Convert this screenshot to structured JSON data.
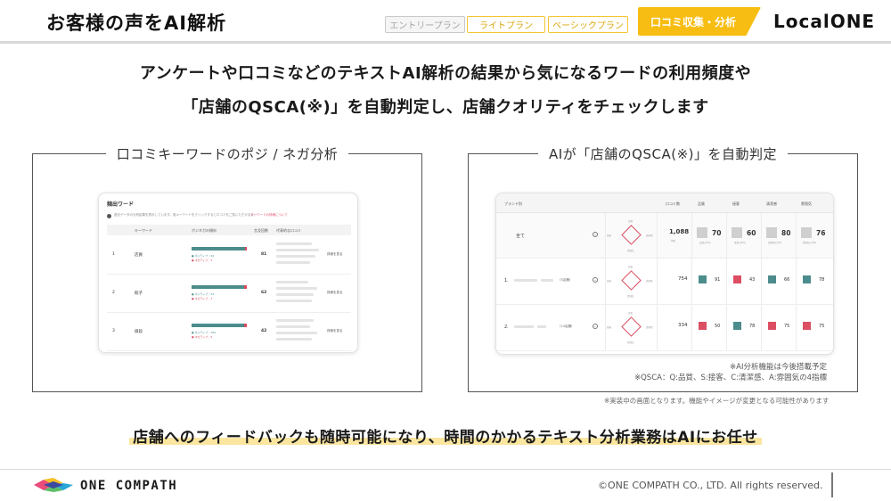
{
  "header": {
    "title": "お客様の声をAI解析",
    "plans": [
      "エントリープラン",
      "ライトプラン",
      "ベーシックプラン"
    ],
    "active_plan": "口コミ収集・分析",
    "brand": "LocalONE"
  },
  "headline": {
    "line1": "アンケートや口コミなどのテキストAI解析の結果から気になるワードの利用頻度や",
    "line2": "「店舗のQSCA(※)」を自動判定し、店舗クオリティをチェックします"
  },
  "left_panel": {
    "label": "口コミキーワードのポジ / ネガ分析",
    "card": {
      "title": "頻出ワード",
      "note": "過去データの分析結果を表示しています。各キーワードをクリックすると口コミをご覧いただけます。",
      "note_link": "キーワードの詳細について",
      "columns": [
        "キーワード",
        "ポジネガの傾向",
        "言及回数",
        "代表的な口コミ"
      ],
      "rows": [
        {
          "rank": "1",
          "word": "店員",
          "pos": "● ポジティブ：64",
          "neg": "● ネガティブ：5",
          "count": "81",
          "pos_ratio": 0.96,
          "detail": "詳細を見る"
        },
        {
          "rank": "2",
          "word": "餃子",
          "pos": "● ポジティブ：54",
          "neg": "● ネガティブ：3",
          "count": "62",
          "pos_ratio": 0.95,
          "detail": "詳細を見る"
        },
        {
          "rank": "3",
          "word": "値段",
          "pos": "● ポジティブ：100",
          "neg": "● ネガティブ：5",
          "count": "42",
          "pos_ratio": 0.95,
          "detail": "詳細を見る"
        }
      ]
    }
  },
  "right_panel": {
    "label": "AIが「店舗のQSCA(※)」を自動判定",
    "card": {
      "columns": [
        "ブランド別",
        "口コミ数",
        "品質",
        "接客",
        "清潔感",
        "雰囲気"
      ],
      "axis_labels": [
        "品質",
        "接客",
        "清潔感",
        "雰囲気"
      ],
      "total_row": {
        "label": "全て",
        "count": "1,088",
        "count_unit": "件数",
        "scores": [
          {
            "value": "70",
            "avg": "品質の平均"
          },
          {
            "value": "60",
            "avg": "接客の平均"
          },
          {
            "value": "80",
            "avg": "清潔感の平均"
          },
          {
            "value": "76",
            "avg": "雰囲気の平均"
          }
        ]
      },
      "rows": [
        {
          "rank": "1.",
          "sub": "（5店舗）",
          "count": "754",
          "scores": [
            {
              "value": "91",
              "color": "#4d8c8c"
            },
            {
              "value": "43",
              "color": "#dc4f63"
            },
            {
              "value": "66",
              "color": "#4d8c8c"
            },
            {
              "value": "78",
              "color": "#4d8c8c"
            }
          ]
        },
        {
          "rank": "2.",
          "sub": "（14店舗）",
          "count": "334",
          "scores": [
            {
              "value": "50",
              "color": "#dc4f63"
            },
            {
              "value": "78",
              "color": "#4d8c8c"
            },
            {
              "value": "75",
              "color": "#dc4f63"
            },
            {
              "value": "75",
              "color": "#dc4f63"
            }
          ]
        }
      ]
    },
    "notes": [
      "※AI分析機能は今後搭載予定",
      "※QSCA：Q:品質、S:接客、C:清潔感、A:雰囲気の4指標"
    ]
  },
  "disclaimer": "※実装中の画面となります。機能やイメージが変更となる可能性があります",
  "bottom_message": "店舗へのフィードバックも随時可能になり、時間のかかるテキスト分析業務はAIにお任せ",
  "footer": {
    "company": "ONE COMPATH",
    "copyright": "©ONE COMPATH CO., LTD. All rights reserved."
  },
  "colors": {
    "accent_yellow": "#f7bd12",
    "positive_teal": "#4d8c8c",
    "negative_red": "#dc4f63"
  }
}
